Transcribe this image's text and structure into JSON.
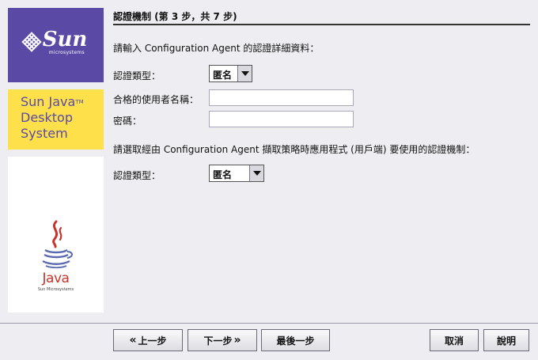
{
  "branding": {
    "sun_word": "Sun",
    "sun_sub": "microsystems",
    "product_lines": [
      "Sun Java",
      "Desktop",
      "System"
    ],
    "product_tm": "TM",
    "java_word": "Java",
    "java_sub": "Sun Microsystems"
  },
  "header": {
    "title": "認證機制 (第 3 步，共 7 步)"
  },
  "main": {
    "instruction_1": "請輸入 Configuration Agent 的認證詳細資料：",
    "auth_type_label": "認證類型：",
    "auth_type_value": "匿名",
    "username_label": "合格的使用者名稱：",
    "username_value": "",
    "password_label": "密碼：",
    "password_value": "",
    "instruction_2": "請選取經由 Configuration Agent 擷取策略時應用程式 (用戶端) 要使用的認證機制：",
    "client_auth_label": "認證類型：",
    "client_auth_value": "匿名"
  },
  "footer": {
    "back": "上一步",
    "next": "下一步",
    "last": "最後一步",
    "cancel": "取消",
    "help": "說明"
  },
  "colors": {
    "sun_purple": "#5a4aa6",
    "jds_yellow": "#fde04a",
    "java_red": "#c8322b",
    "java_blue": "#5a6ab0"
  }
}
